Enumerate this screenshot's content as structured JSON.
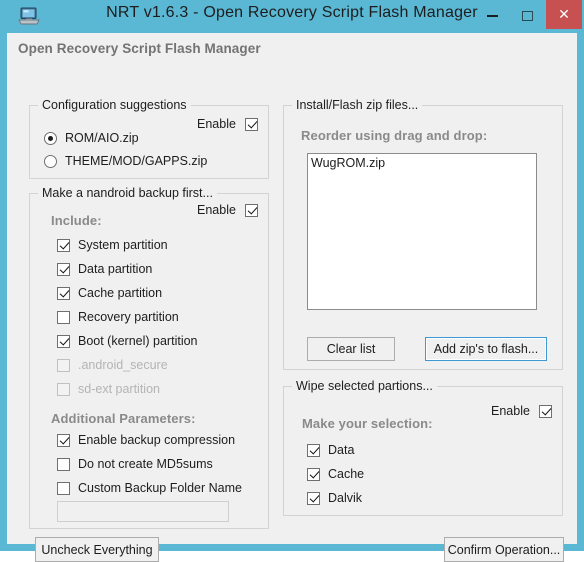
{
  "window": {
    "title": "NRT v1.6.3 - Open Recovery Script Flash Manager",
    "app_icon": "computer-monitor-icon",
    "titlebar_color": "#5bb8d4",
    "close_button_color": "#c75050",
    "controls": {
      "minimize": "–",
      "maximize": "□",
      "close": "✕"
    }
  },
  "header": {
    "label": "Open Recovery Script Flash Manager"
  },
  "config_group": {
    "title": "Configuration suggestions",
    "enable_label": "Enable",
    "enable_checked": true,
    "options": [
      {
        "label": "ROM/AIO.zip",
        "selected": true
      },
      {
        "label": "THEME/MOD/GAPPS.zip",
        "selected": false
      }
    ]
  },
  "backup_group": {
    "title": "Make a nandroid backup first...",
    "enable_label": "Enable",
    "enable_checked": true,
    "include_label": "Include:",
    "include_items": [
      {
        "label": "System partition",
        "checked": true,
        "disabled": false
      },
      {
        "label": "Data partition",
        "checked": true,
        "disabled": false
      },
      {
        "label": "Cache partition",
        "checked": true,
        "disabled": false
      },
      {
        "label": "Recovery partition",
        "checked": false,
        "disabled": false
      },
      {
        "label": "Boot (kernel) partition",
        "checked": true,
        "disabled": false
      },
      {
        "label": ".android_secure",
        "checked": false,
        "disabled": true
      },
      {
        "label": "sd-ext partition",
        "checked": false,
        "disabled": true
      }
    ],
    "additional_label": "Additional Parameters:",
    "additional_items": [
      {
        "label": "Enable backup compression",
        "checked": true,
        "disabled": false
      },
      {
        "label": "Do not create MD5sums",
        "checked": false,
        "disabled": false
      },
      {
        "label": "Custom Backup Folder Name",
        "checked": false,
        "disabled": false
      }
    ],
    "custom_folder_value": "",
    "custom_folder_placeholder": ""
  },
  "install_group": {
    "title": "Install/Flash zip files...",
    "reorder_label": "Reorder using drag and drop:",
    "zip_files": [
      "WugROM.zip"
    ],
    "clear_button": "Clear list",
    "add_button": "Add zip's to flash...",
    "add_button_focused": true
  },
  "wipe_group": {
    "title": "Wipe selected partions...",
    "enable_label": "Enable",
    "enable_checked": true,
    "selection_label": "Make your selection:",
    "items": [
      {
        "label": "Data",
        "checked": true
      },
      {
        "label": "Cache",
        "checked": true
      },
      {
        "label": "Dalvik",
        "checked": true
      }
    ]
  },
  "footer": {
    "uncheck_button": "Uncheck Everything",
    "confirm_button": "Confirm Operation..."
  }
}
